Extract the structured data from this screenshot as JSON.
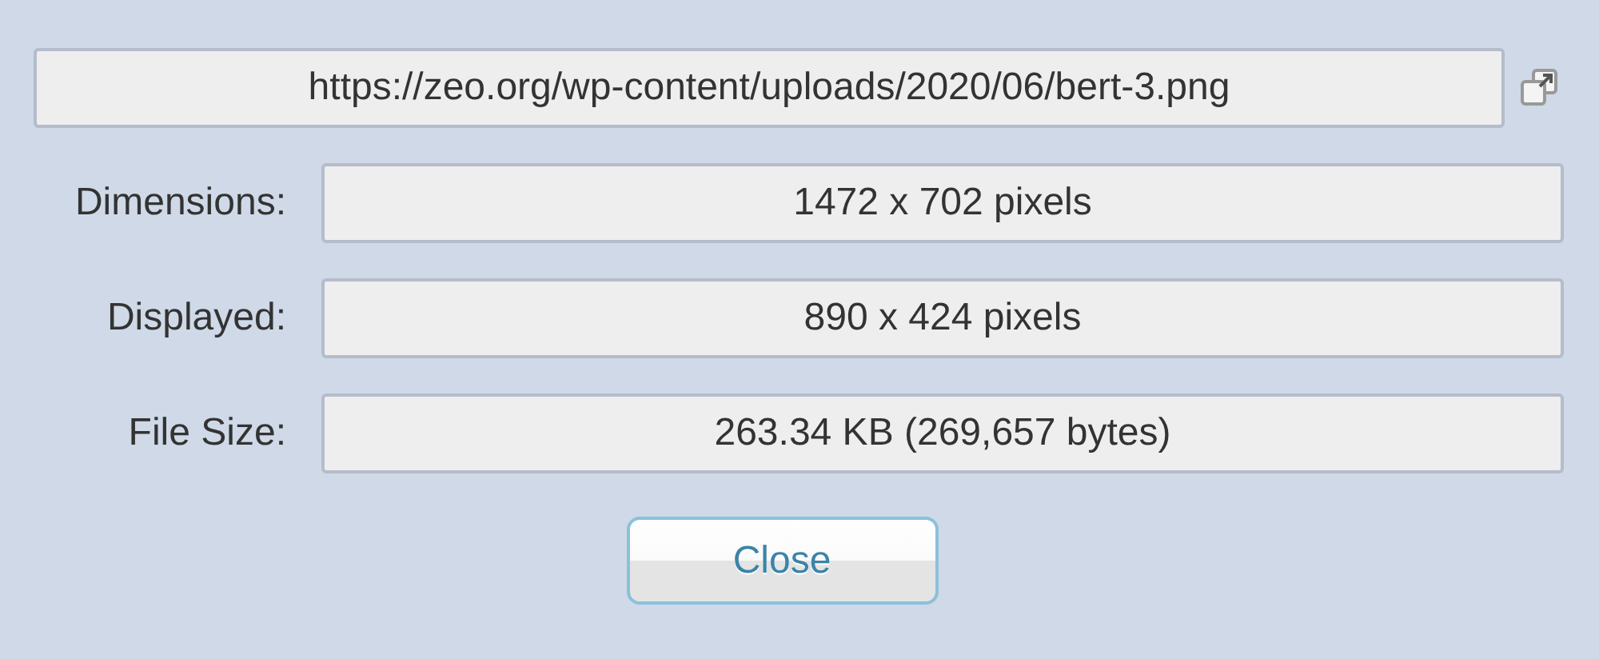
{
  "url_field": {
    "value": "https://zeo.org/wp-content/uploads/2020/06/bert-3.png"
  },
  "properties": [
    {
      "label": "Dimensions:",
      "value": "1472 x 702 pixels"
    },
    {
      "label": "Displayed:",
      "value": "890 x 424 pixels"
    },
    {
      "label": "File Size:",
      "value": "263.34 KB (269,657 bytes)"
    }
  ],
  "buttons": [
    "Close"
  ]
}
